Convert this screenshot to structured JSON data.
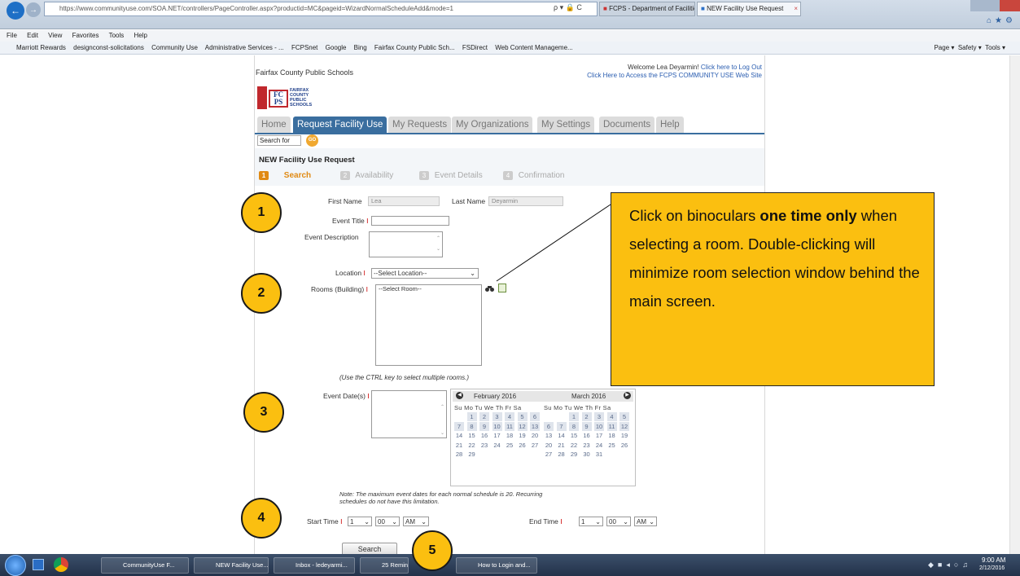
{
  "browser": {
    "url": "https://www.communityuse.com/SOA.NET/controllers/PageController.aspx?productid=MC&pageid=WizardNormalScheduleAdd&mode=1",
    "search_suffix": "ρ ▾ 🔒 C",
    "tabs": [
      "FCPS - Department of Facilities...",
      "NEW Facility Use Request"
    ],
    "menu": [
      "File",
      "Edit",
      "View",
      "Favorites",
      "Tools",
      "Help"
    ],
    "favorites": [
      "Marriott Rewards",
      "designconst-solicitations",
      "Community Use",
      "Administrative Services - ...",
      "FCPSnet",
      "Google",
      "Bing",
      "Fairfax County Public Sch...",
      "FSDirect",
      "Web Content Manageme..."
    ],
    "toolbar_right": [
      "Page ▾",
      "Safety ▾",
      "Tools ▾"
    ]
  },
  "page": {
    "org_name": "Fairfax County Public Schools",
    "welcome": "Welcome Lea Deyarmin!",
    "logout": "Click here to Log Out",
    "community_link": "Click Here to Access the FCPS COMMUNITY USE Web Site",
    "logo_letters": "FC PS",
    "logo_text": [
      "FAIRFAX",
      "COUNTY",
      "PUBLIC",
      "SCHOOLS"
    ],
    "nav_tabs": [
      "Home",
      "Request Facility Use",
      "My Requests",
      "My Organizations",
      "My Settings",
      "Documents",
      "Help"
    ],
    "search_label": "Search for",
    "go_label": "GO",
    "form_title": "NEW Facility Use Request",
    "steps": [
      {
        "num": "1",
        "label": "Search"
      },
      {
        "num": "2",
        "label": "Availability"
      },
      {
        "num": "3",
        "label": "Event Details"
      },
      {
        "num": "4",
        "label": "Confirmation"
      }
    ]
  },
  "form": {
    "first_name_label": "First Name",
    "first_name_value": "Lea",
    "last_name_label": "Last Name",
    "last_name_value": "Deyarmin",
    "event_title_label": "Event Title",
    "event_desc_label": "Event Description",
    "location_label": "Location",
    "location_value": "--Select Location--",
    "rooms_label": "Rooms (Building)",
    "rooms_value": "--Select Room--",
    "ctrl_note": "(Use the CTRL key to select multiple rooms.)",
    "event_dates_label": "Event Date(s)",
    "note_line1": "Note: The maximum event dates for each normal schedule is 20. Recurring",
    "note_line2": "schedules do not have this limitation.",
    "start_time_label": "Start Time",
    "end_time_label": "End Time",
    "hour": "1",
    "minute": "00",
    "ampm": "AM",
    "search_button": "Search",
    "required_mark": "I"
  },
  "calendar": {
    "dow": "Su Mo Tu We Th Fr Sa",
    "months": [
      {
        "title": "February 2016",
        "days": [
          [
            "",
            "1",
            "2",
            "3",
            "4",
            "5",
            "6"
          ],
          [
            "7",
            "8",
            "9",
            "10",
            "11",
            "12",
            "13"
          ],
          [
            "14",
            "15",
            "16",
            "17",
            "18",
            "19",
            "20"
          ],
          [
            "21",
            "22",
            "23",
            "24",
            "25",
            "26",
            "27"
          ],
          [
            "28",
            "29",
            "",
            "",
            "",
            "",
            ""
          ]
        ]
      },
      {
        "title": "March 2016",
        "days": [
          [
            "",
            "",
            "1",
            "2",
            "3",
            "4",
            "5"
          ],
          [
            "6",
            "7",
            "8",
            "9",
            "10",
            "11",
            "12"
          ],
          [
            "13",
            "14",
            "15",
            "16",
            "17",
            "18",
            "19"
          ],
          [
            "20",
            "21",
            "22",
            "23",
            "24",
            "25",
            "26"
          ],
          [
            "27",
            "28",
            "29",
            "30",
            "31",
            "",
            ""
          ]
        ]
      }
    ]
  },
  "annotations": {
    "badges": [
      "1",
      "2",
      "3",
      "4",
      "5"
    ],
    "callout_pre": "Click on binoculars ",
    "callout_bold": "one time only",
    "callout_post": " when selecting a room. Double-clicking will minimize room selection window behind the main screen."
  },
  "taskbar": {
    "items": [
      "CommunityUse F...",
      "NEW Facility Use...",
      "Inbox - ledeyarmi...",
      "25 Remin...",
      "How to Login and..."
    ],
    "time": "9:00 AM",
    "date": "2/12/2016"
  },
  "colors": {
    "accent": "#3a6e9f",
    "callout": "#fbbf10",
    "required": "#cc0000"
  }
}
